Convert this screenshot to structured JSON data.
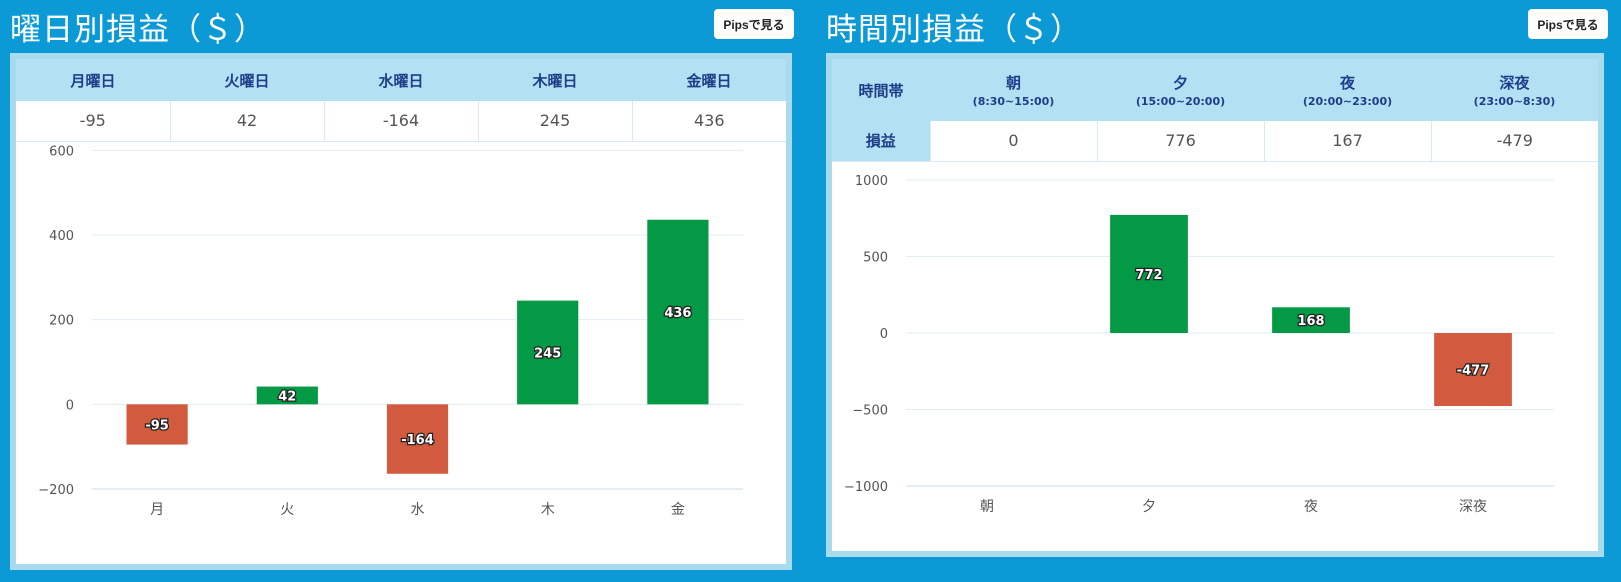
{
  "colors": {
    "positive": "#049a45",
    "negative": "#d25a3f",
    "background": "#0b9ad6",
    "header": "#b3e0f2"
  },
  "weekday": {
    "title": "曜日別損益（＄）",
    "pips_button": "Pipsで見る",
    "headers": [
      "月曜日",
      "火曜日",
      "水曜日",
      "木曜日",
      "金曜日"
    ],
    "values": [
      "-95",
      "42",
      "-164",
      "245",
      "436"
    ]
  },
  "timeslot": {
    "title": "時間別損益（＄）",
    "pips_button": "Pipsで見る",
    "row_header": "時間帯",
    "row_value_label": "損益",
    "headers": [
      {
        "name": "朝",
        "range": "(8:30~15:00)"
      },
      {
        "name": "夕",
        "range": "(15:00~20:00)"
      },
      {
        "name": "夜",
        "range": "(20:00~23:00)"
      },
      {
        "name": "深夜",
        "range": "(23:00~8:30)"
      }
    ],
    "values": [
      "0",
      "776",
      "167",
      "-479"
    ]
  },
  "chart_data": [
    {
      "type": "bar",
      "categories": [
        "月",
        "火",
        "水",
        "木",
        "金"
      ],
      "values": [
        -95,
        42,
        -164,
        245,
        436
      ],
      "labels": [
        "-95",
        "42",
        "-164",
        "245",
        "436"
      ],
      "yticks": [
        600,
        400,
        200,
        0,
        -200
      ],
      "ylim": [
        -200,
        700
      ],
      "grid": true
    },
    {
      "type": "bar",
      "categories": [
        "朝",
        "夕",
        "夜",
        "深夜"
      ],
      "values": [
        0,
        772,
        168,
        -477
      ],
      "labels": [
        "",
        "772",
        "168",
        "-477"
      ],
      "yticks": [
        1000,
        500,
        0,
        -500,
        -1000
      ],
      "ylim": [
        -1000,
        1000
      ],
      "grid": true
    }
  ]
}
